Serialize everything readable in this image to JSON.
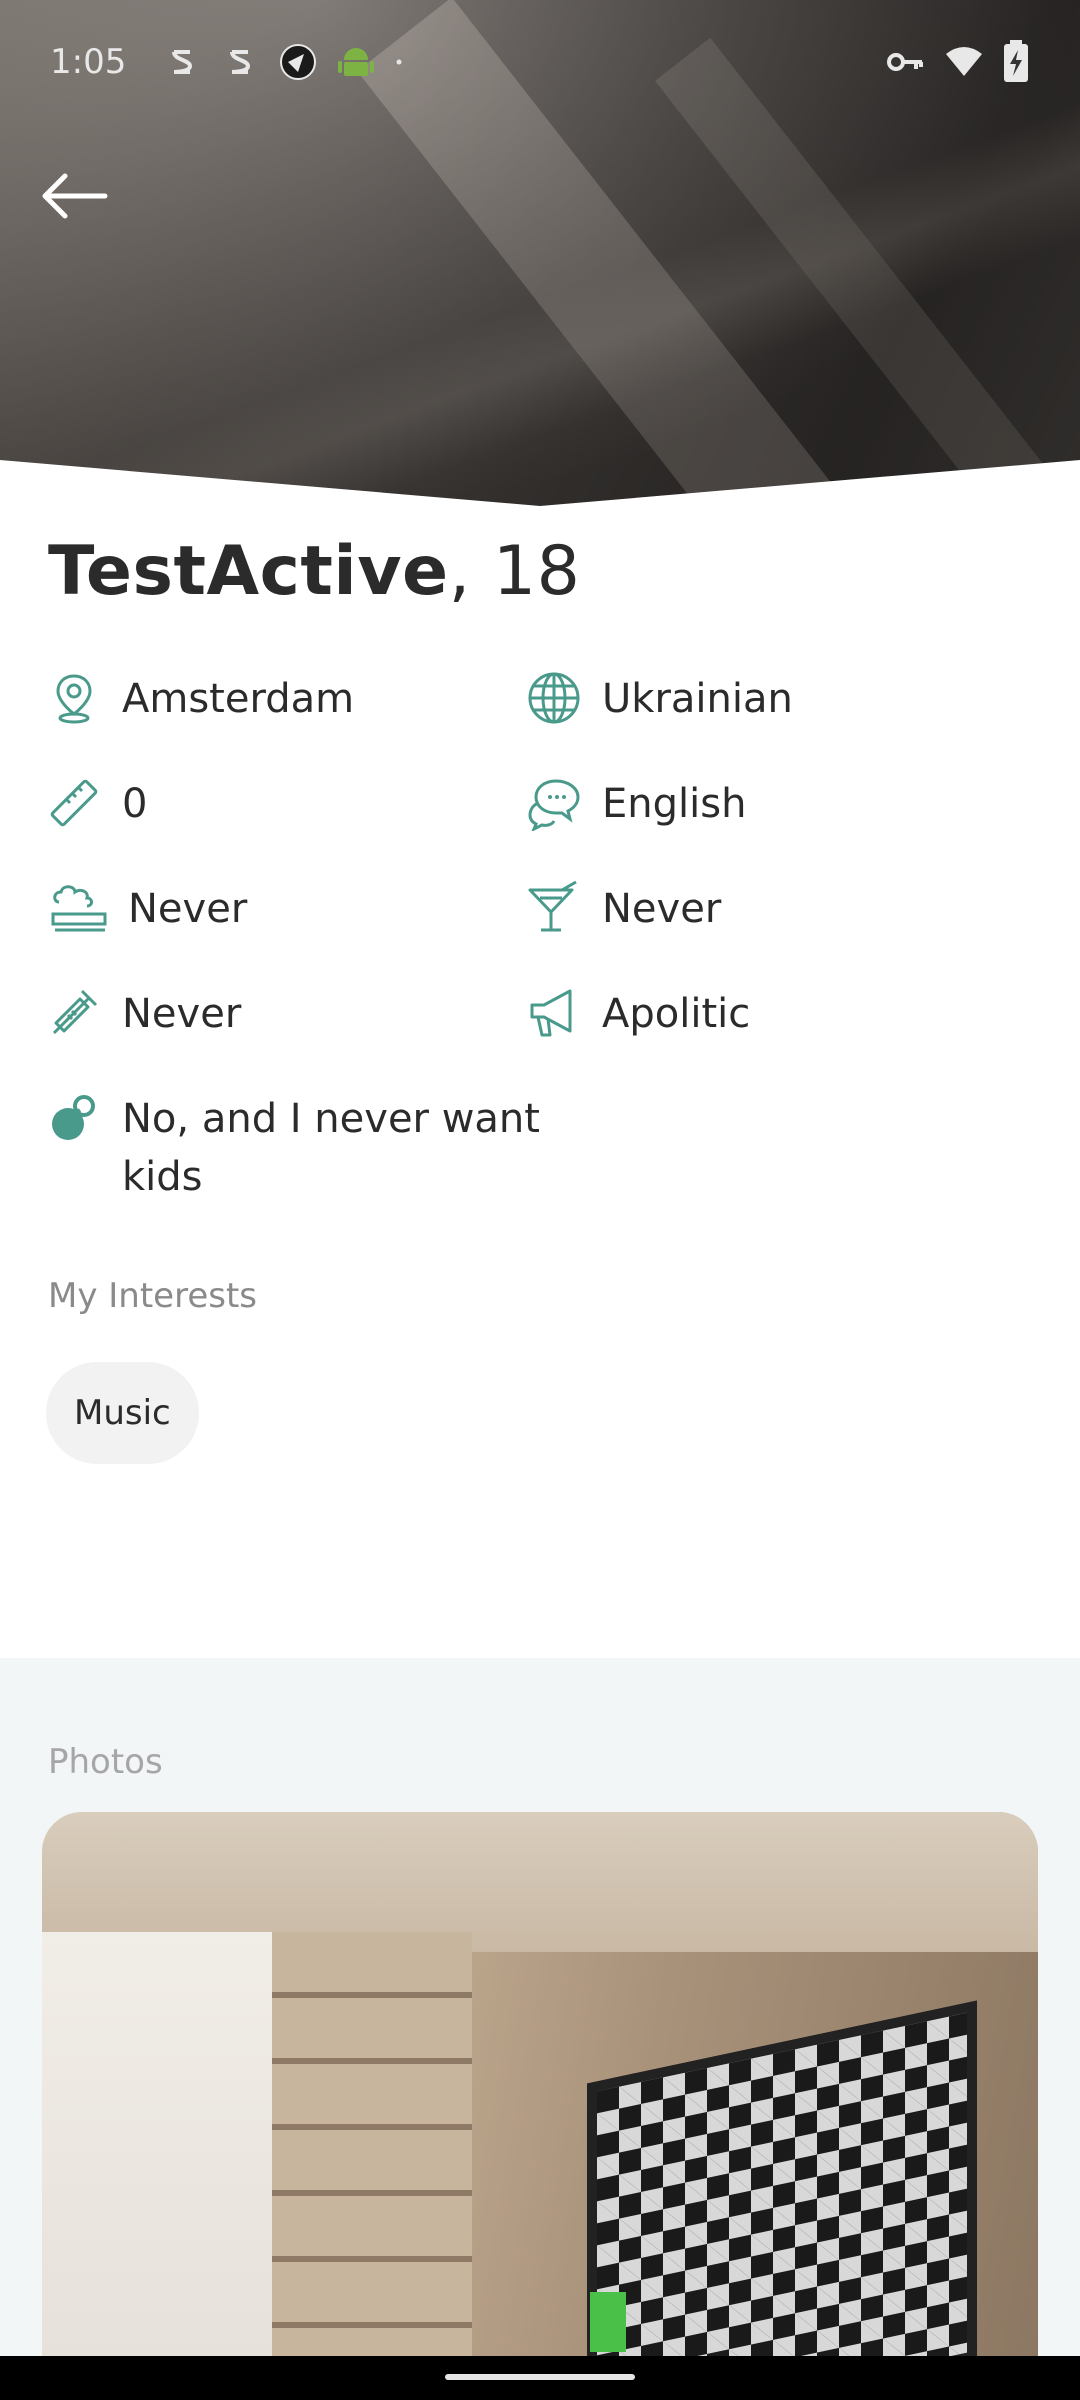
{
  "status_bar": {
    "time": "1:05"
  },
  "profile": {
    "name": "TestActive",
    "age_text": ", 18"
  },
  "attributes": {
    "location": "Amsterdam",
    "nationality": "Ukrainian",
    "height": "0",
    "language": "English",
    "smoking": "Never",
    "drinking": "Never",
    "drugs": "Never",
    "politics": "Apolitic",
    "kids_line1": "No, and I never want",
    "kids_line2": "kids"
  },
  "interests": {
    "title": "My Interests",
    "items": [
      "Music"
    ]
  },
  "photos": {
    "title": "Photos"
  },
  "colors": {
    "accent": "#4a9a8c",
    "chip_bg": "#f2f2f2",
    "section_bg": "#f3f6f6"
  }
}
